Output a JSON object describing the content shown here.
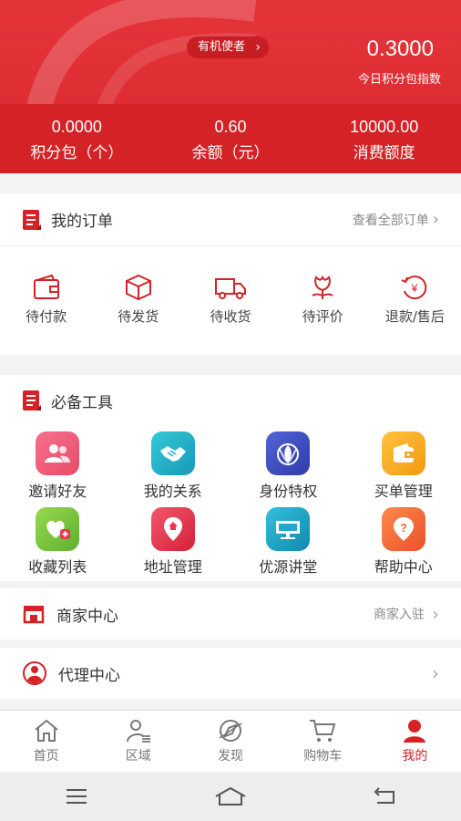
{
  "header": {
    "role_badge": "有机使者",
    "index_value": "0.3000",
    "index_label": "今日积分包指数",
    "stats": [
      {
        "value": "0.0000",
        "label": "积分包（个）"
      },
      {
        "value": "0.60",
        "label": "余额（元）"
      },
      {
        "value": "10000.00",
        "label": "消费额度"
      }
    ],
    "bg_color": "#d42226"
  },
  "orders": {
    "title": "我的订单",
    "view_all": "查看全部订单",
    "items": [
      {
        "label": "待付款",
        "icon": "wallet-icon"
      },
      {
        "label": "待发货",
        "icon": "package-icon"
      },
      {
        "label": "待收货",
        "icon": "truck-icon"
      },
      {
        "label": "待评价",
        "icon": "flower-icon"
      },
      {
        "label": "退款/售后",
        "icon": "refund-icon"
      }
    ]
  },
  "tools": {
    "title": "必备工具",
    "items": [
      {
        "label": "邀请好友",
        "icon": "invite-friends-icon",
        "color": "#f0566d"
      },
      {
        "label": "我的关系",
        "icon": "handshake-icon",
        "color": "#1fb6c8"
      },
      {
        "label": "身份特权",
        "icon": "identity-icon",
        "color": "#3d4fbf"
      },
      {
        "label": "买单管理",
        "icon": "bill-icon",
        "color": "#f6a623"
      },
      {
        "label": "收藏列表",
        "icon": "favorites-icon",
        "color": "#7ac943"
      },
      {
        "label": "地址管理",
        "icon": "location-icon",
        "color": "#e8384f"
      },
      {
        "label": "优源讲堂",
        "icon": "lecture-icon",
        "color": "#1fa8c9"
      },
      {
        "label": "帮助中心",
        "icon": "help-icon",
        "color": "#f26a3d"
      }
    ]
  },
  "merchant": {
    "title": "商家中心",
    "action": "商家入驻"
  },
  "agent": {
    "title": "代理中心"
  },
  "tabbar": {
    "items": [
      {
        "label": "首页",
        "icon": "home-icon"
      },
      {
        "label": "区域",
        "icon": "region-icon"
      },
      {
        "label": "发现",
        "icon": "discover-icon"
      },
      {
        "label": "购物车",
        "icon": "cart-icon"
      },
      {
        "label": "我的",
        "icon": "profile-icon",
        "active": true
      }
    ],
    "active_color": "#d42226"
  }
}
